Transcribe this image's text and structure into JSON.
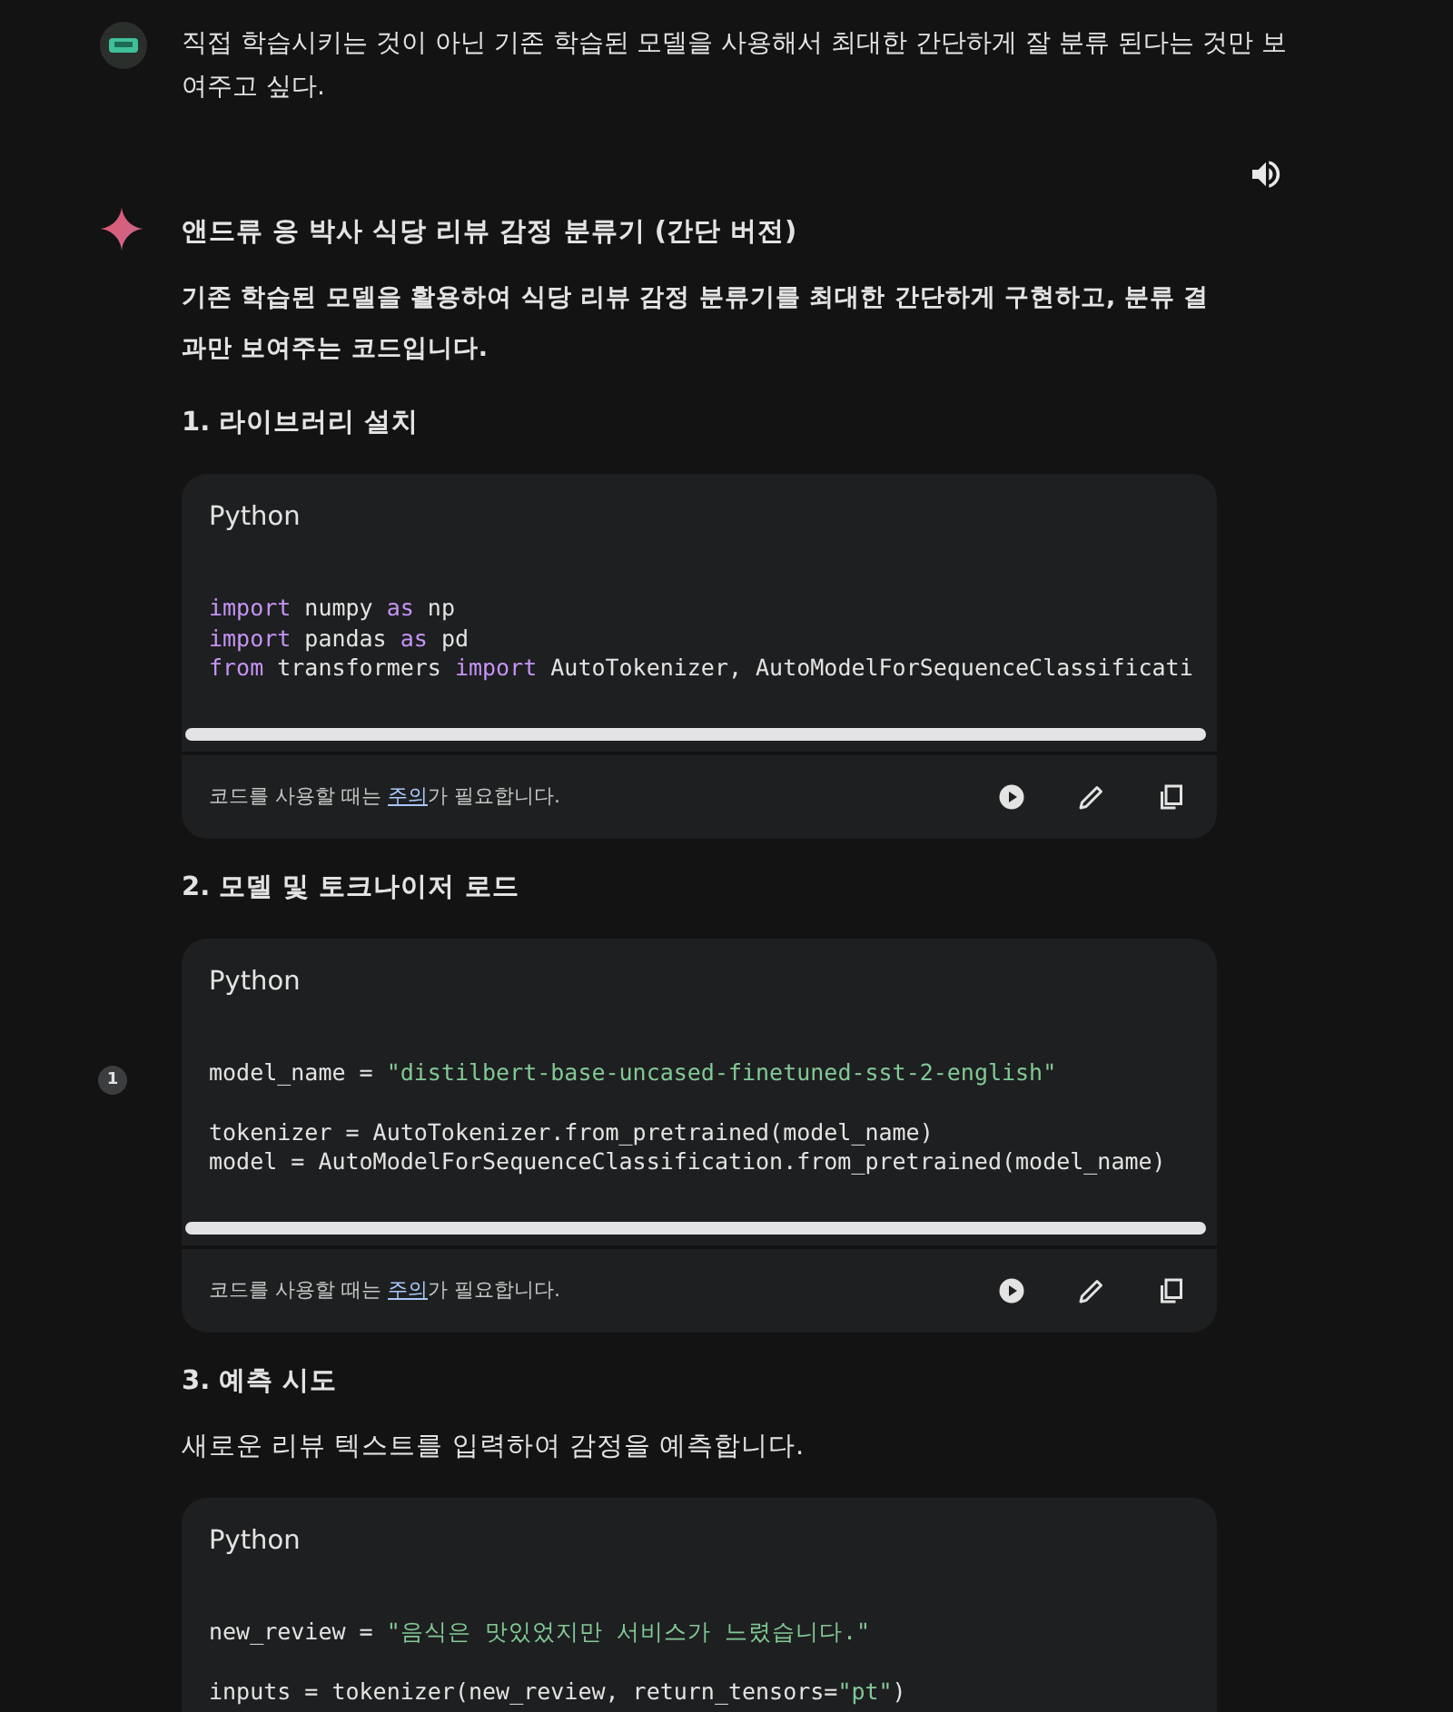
{
  "user_message": {
    "text": "직접 학습시키는 것이 아닌 기존 학습된 모델을 사용해서 최대한 간단하게 잘 분류 된다는 것만 보여주고 싶다."
  },
  "response": {
    "title": "앤드류 응 박사 식당 리뷰 감정 분류기 (간단 버전)",
    "intro": "기존 학습된 모델을 활용하여 식당 리뷰 감정 분류기를 최대한 간단하게 구현하고, 분류 결과만 보여주는 코드입니다.",
    "sections": [
      {
        "heading": "1. 라이브러리 설치",
        "code": {
          "language": "Python",
          "footer": {
            "before": "코드를 사용할 때는 ",
            "link": "주의",
            "after": "가 필요합니다."
          },
          "lines": [
            {
              "kind": "code",
              "tokens": [
                {
                  "kind": "keyword",
                  "text": "import"
                },
                {
                  "kind": "plain",
                  "text": " numpy "
                },
                {
                  "kind": "keyword",
                  "text": "as"
                },
                {
                  "kind": "plain",
                  "text": " np"
                }
              ]
            },
            {
              "kind": "code",
              "tokens": [
                {
                  "kind": "keyword",
                  "text": "import"
                },
                {
                  "kind": "plain",
                  "text": " pandas "
                },
                {
                  "kind": "keyword",
                  "text": "as"
                },
                {
                  "kind": "plain",
                  "text": " pd"
                }
              ]
            },
            {
              "kind": "code",
              "tokens": [
                {
                  "kind": "keyword",
                  "text": "from"
                },
                {
                  "kind": "plain",
                  "text": " transformers "
                },
                {
                  "kind": "keyword",
                  "text": "import"
                },
                {
                  "kind": "plain",
                  "text": " AutoTokenizer, AutoModelForSequenceClassificati"
                }
              ]
            }
          ]
        }
      },
      {
        "heading": "2. 모델 및 토크나이저 로드",
        "code": {
          "language": "Python",
          "citation": "1",
          "footer": {
            "before": "코드를 사용할 때는 ",
            "link": "주의",
            "after": "가 필요합니다."
          },
          "lines": [
            {
              "kind": "code",
              "tokens": [
                {
                  "kind": "plain",
                  "text": "model_name = "
                },
                {
                  "kind": "string",
                  "text": "\"distilbert-base-uncased-finetuned-sst-2-english\""
                }
              ]
            },
            {
              "kind": "blank"
            },
            {
              "kind": "code",
              "tokens": [
                {
                  "kind": "plain",
                  "text": "tokenizer = AutoTokenizer.from_pretrained(model_name)"
                }
              ]
            },
            {
              "kind": "code",
              "tokens": [
                {
                  "kind": "plain",
                  "text": "model = AutoModelForSequenceClassification.from_pretrained(model_name)"
                }
              ]
            }
          ]
        }
      },
      {
        "heading": "3. 예측 시도",
        "text": "새로운 리뷰 텍스트를 입력하여 감정을 예측합니다.",
        "code": {
          "language": "Python",
          "lines": [
            {
              "kind": "code",
              "tokens": [
                {
                  "kind": "plain",
                  "text": "new_review = "
                },
                {
                  "kind": "string",
                  "text": "\"음식은 맛있었지만 서비스가 느렸습니다.\""
                }
              ]
            },
            {
              "kind": "blank"
            },
            {
              "kind": "code",
              "tokens": [
                {
                  "kind": "plain",
                  "text": "inputs = tokenizer(new_review, return_tensors="
                },
                {
                  "kind": "string",
                  "text": "\"pt\""
                },
                {
                  "kind": "plain",
                  "text": ")"
                }
              ]
            }
          ]
        }
      }
    ]
  }
}
